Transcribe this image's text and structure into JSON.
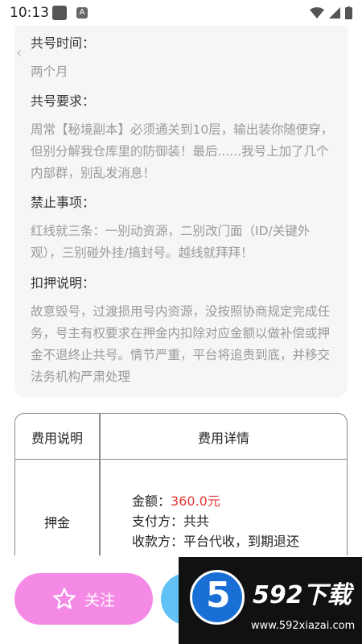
{
  "status_bar": {
    "time": "10:13"
  },
  "sections": [
    {
      "title": "共号时间：",
      "text": "两个月"
    },
    {
      "title": "共号要求：",
      "text": "周常【秘境副本】必须通关到10层，输出装你随便穿，但别分解我仓库里的防御装！最后......我号上加了几个内部群，别乱发消息！"
    },
    {
      "title": "禁止事项：",
      "text": "红线就三条：一别动资源，二别改门面（ID/关键外观），三别碰外挂/搞封号。越线就拜拜！"
    },
    {
      "title": "扣押说明：",
      "text": "故意毁号，过渡损用号内资源，没按照协商规定完成任务，号主有权要求在押金内扣除对应金额以做补偿或押金不退终止共号。情节严重，平台将追责到底，并移交法务机构严肃处理"
    }
  ],
  "fee_table": {
    "header_left": "费用说明",
    "header_right": "费用详情",
    "row_label": "押金",
    "amount_label": "金额：",
    "amount_value": "360.0元",
    "payer_label": "支付方：共共",
    "payee_label": "收款方：平台代收，到期退还"
  },
  "bottom_bar": {
    "follow_label": "关注"
  },
  "watermark": {
    "brand": "592下载",
    "url": "www.592xiazai.com",
    "badge": "5"
  },
  "colors": {
    "accent_pink": "#f58ae6",
    "accent_blue": "#62c2f5",
    "amount_red": "#e53935"
  }
}
